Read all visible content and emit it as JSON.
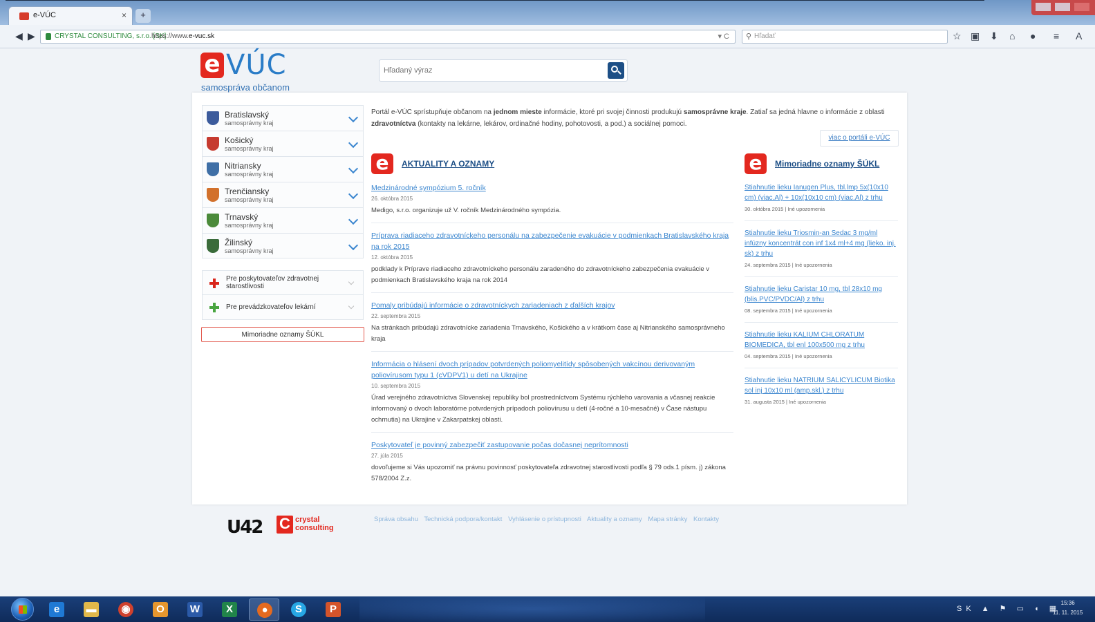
{
  "browser": {
    "tab_title": "e-VÚC",
    "tab_close": "×",
    "new_tab": "+",
    "identity": "CRYSTAL CONSULTING, s.r.o. [SK]",
    "url_prefix": "https://www.",
    "url_domain": "e-vuc.sk",
    "url_tools": "▾ C",
    "search_placeholder": "Hľadať"
  },
  "site": {
    "logo_e": "e",
    "logo_vuc": "VÚC",
    "tagline": "samospráva občanom",
    "search_placeholder": "Hľadaný výraz"
  },
  "regions": [
    {
      "name": "Bratislavský",
      "sub": "samosprávny kraj",
      "color": "#3c5b9c"
    },
    {
      "name": "Košický",
      "sub": "samosprávny kraj",
      "color": "#c63a2f"
    },
    {
      "name": "Nitriansky",
      "sub": "samosprávny kraj",
      "color": "#3f6fa6"
    },
    {
      "name": "Trenčiansky",
      "sub": "samosprávny kraj",
      "color": "#d2712c"
    },
    {
      "name": "Trnavský",
      "sub": "samosprávny kraj",
      "color": "#4b8a3a"
    },
    {
      "name": "Žilinský",
      "sub": "samosprávny kraj",
      "color": "#3a6b3a"
    }
  ],
  "links": [
    {
      "label": "Pre poskytovateľov zdravotnej starostlivosti",
      "icon": "red-cross-icon"
    },
    {
      "label": "Pre prevádzkovateľov lekární",
      "icon": "green-cross-icon"
    }
  ],
  "alert_button": "Mimoriadne oznamy ŠÚKL",
  "intro": {
    "p1": "Portál e-VÚC sprístupňuje občanom na ",
    "b1": "jednom mieste",
    "p2": " informácie, ktoré pri svojej činnosti produkujú ",
    "b2": "samosprávne kraje",
    "p3": ". Zatiaľ sa jedná hlavne o informácie z oblasti ",
    "b3": "zdravotníctva",
    "p4": " (kontakty na lekárne, lekárov, ordinačné hodiny, pohotovosti, a pod.) a sociálnej pomoci.",
    "more": "viac o portáli e-VÚC"
  },
  "news_heading": "AKTUALITY A OZNAMY",
  "news": [
    {
      "title": "Medzinárodné sympózium 5. ročník",
      "date": "26. októbra 2015",
      "text": "Medigo, s.r.o. organizuje už V. ročník Medzinárodného sympózia."
    },
    {
      "title": "Príprava riadiaceho zdravotníckeho personálu na zabezpečenie evakuácie v podmienkach Bratislavského kraja na rok 2015",
      "date": "12. októbra 2015",
      "text": "podklady k Príprave riadiaceho zdravotníckeho personálu zaradeného do zdravotníckeho zabezpečenia evakuácie v podmienkach Bratislavského kraja na rok 2014"
    },
    {
      "title": "Pomaly pribúdajú informácie o zdravotníckych zariadeniach z ďalších krajov",
      "date": "22. septembra 2015",
      "text": "Na stránkach pribúdajú zdravotnícke zariadenia Trnavského, Košického a v krátkom čase aj Nitrianského samosprávneho kraja"
    },
    {
      "title": "Informácia o hlásení dvoch prípadov potvrdených poliomyelitídy spôsobených vakcínou derivovaným poliovírusom typu 1 (cVDPV1) u detí na Ukrajine",
      "date": "10. septembra 2015",
      "text": "Úrad verejného zdravotníctva Slovenskej republiky bol prostredníctvom Systému rýchleho varovania a včasnej reakcie informovaný o dvoch laboratórne potvrdených prípadoch poliovírusu u detí (4-ročné a 10-mesačné) v Čase nástupu ochrnutia) na Ukrajine v Zakarpatskej oblasti."
    },
    {
      "title": "Poskytovateľ je povinný zabezpečiť zastupovanie počas dočasnej neprítomnosti",
      "date": "27. júla 2015",
      "text": "dovoľujeme si Vás upozorniť na právnu povinnosť poskytovateľa zdravotnej starostlivosti podľa § 79 ods.1 písm. j) zákona 578/2004 Z.z."
    }
  ],
  "notices_heading": "Mimoriadne oznamy ŠÚKL",
  "notices": [
    {
      "title": "Stiahnutie lieku Ianugen Plus, tbl.lmp 5x(10x10 cm) (viac.Al) + 10x(10x10 cm) (viac.Al) z trhu",
      "date": "30. októbra 2015 | Iné upozornenia"
    },
    {
      "title": "Stiahnutie lieku Triosmin-an Sedac 3 mg/ml infúzny koncentrát con inf 1x4 ml+4 mg (lieko. inj. sk) z trhu",
      "date": "24. septembra 2015 | Iné upozornenia"
    },
    {
      "title": "Stiahnutie lieku Caristar 10 mg, tbl 28x10 mg (blis.PVC/PVDC/Al) z trhu",
      "date": "08. septembra 2015 | Iné upozornenia"
    },
    {
      "title": "Stiahnutie lieku KALIUM CHLORATUM BIOMEDICA, tbl enl 100x500 mg z trhu",
      "date": "04. septembra 2015 | Iné upozornenia"
    },
    {
      "title": "Stiahnutie lieku NATRIUM SALICYLICUM Biotika sol inj 10x10 ml (amp.skl.) z trhu",
      "date": "31. augusta 2015 | Iné upozornenia"
    }
  ],
  "footer": {
    "logo1": "ᑌ42",
    "logo2_c": "C",
    "logo2_w1": "crystal",
    "logo2_w2": "consulting",
    "links": [
      "Správa obsahu",
      "Technická podpora/kontakt",
      "Vyhlásenie o prístupnosti",
      "Aktuality a oznamy",
      "Mapa stránky",
      "Kontakty"
    ]
  },
  "taskbar": {
    "tray": "SK",
    "time": "15:36",
    "date": "11. 11. 2015"
  }
}
